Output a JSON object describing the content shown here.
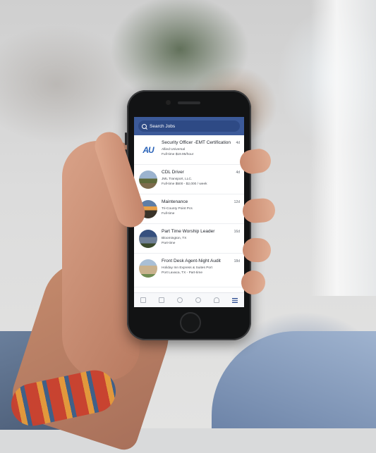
{
  "header": {
    "search_placeholder": "Search Jobs"
  },
  "jobs": [
    {
      "title": "Security Officer -EMT Certification",
      "company": "Allied Universal",
      "meta": "Full-time $19.95/hour",
      "age": "4d",
      "thumb": "AU"
    },
    {
      "title": "CDL Driver",
      "company": "JML Transport, LLC.",
      "meta": "Full-time $500 - $2,000 / week",
      "age": "4d"
    },
    {
      "title": "Maintenance",
      "company": "Tri-County Point Pcs",
      "meta": "Full-time",
      "age": "12d"
    },
    {
      "title": "Part Time Worship Leader",
      "company": "Bloomington, TX",
      "meta": "Part-time",
      "age": "16d"
    },
    {
      "title": "Front Desk Agent-Night Audit",
      "company": "Holiday Inn Express & Suites Port",
      "meta": "Port Lavaca, TX - Part-time",
      "age": "18d"
    }
  ],
  "bottom_nav": {
    "icons": [
      "feed-icon",
      "groups-icon",
      "profile-icon",
      "marketplace-icon",
      "notifications-icon",
      "menu-icon"
    ],
    "active_color": "#3c5a99"
  },
  "colors": {
    "brand": "#3c5a99"
  }
}
